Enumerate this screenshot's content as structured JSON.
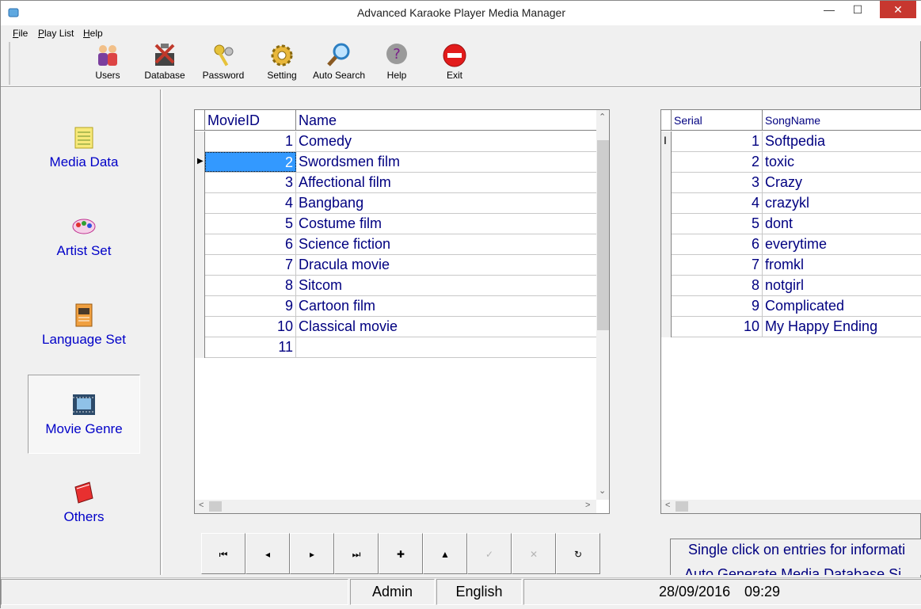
{
  "window": {
    "title": "Advanced Karaoke Player Media Manager"
  },
  "menu": {
    "items": [
      {
        "mnemonic": "F",
        "rest": "ile"
      },
      {
        "mnemonic": "P",
        "rest": "lay List"
      },
      {
        "mnemonic": "H",
        "rest": "elp"
      }
    ]
  },
  "toolbar": {
    "items": [
      {
        "label": "Users",
        "icon": "users-icon"
      },
      {
        "label": "Database",
        "icon": "database-tools-icon"
      },
      {
        "label": "Password",
        "icon": "keys-icon"
      },
      {
        "label": "Setting",
        "icon": "gear-icon"
      },
      {
        "label": "Auto Search",
        "icon": "magnifier-icon"
      },
      {
        "label": "Help",
        "icon": "help-icon"
      },
      {
        "label": "Exit",
        "icon": "exit-icon"
      }
    ]
  },
  "sidebar": {
    "items": [
      {
        "label": "Media Data",
        "icon": "media-data-icon"
      },
      {
        "label": "Artist Set",
        "icon": "artist-set-icon"
      },
      {
        "label": "Language Set",
        "icon": "language-set-icon"
      },
      {
        "label": "Movie Genre",
        "icon": "movie-genre-icon",
        "active": true
      },
      {
        "label": "Others",
        "icon": "others-icon"
      }
    ]
  },
  "genre_grid": {
    "headers": [
      "MovieID",
      "Name"
    ],
    "rows": [
      {
        "id": "1",
        "name": "Comedy"
      },
      {
        "id": "2",
        "name": "Swordsmen film",
        "selected": true
      },
      {
        "id": "3",
        "name": "Affectional film"
      },
      {
        "id": "4",
        "name": "Bangbang"
      },
      {
        "id": "5",
        "name": "Costume film"
      },
      {
        "id": "6",
        "name": "Science fiction"
      },
      {
        "id": "7",
        "name": "Dracula movie"
      },
      {
        "id": "8",
        "name": "Sitcom"
      },
      {
        "id": "9",
        "name": "Cartoon film"
      },
      {
        "id": "10",
        "name": "Classical movie"
      },
      {
        "id": "11",
        "name": ""
      }
    ]
  },
  "song_grid": {
    "headers": [
      "Serial",
      "SongName"
    ],
    "rows": [
      {
        "serial": "1",
        "name": "Softpedia"
      },
      {
        "serial": "2",
        "name": "toxic"
      },
      {
        "serial": "3",
        "name": "Crazy"
      },
      {
        "serial": "4",
        "name": "crazykl"
      },
      {
        "serial": "5",
        "name": "dont"
      },
      {
        "serial": "6",
        "name": "everytime"
      },
      {
        "serial": "7",
        "name": "fromkl"
      },
      {
        "serial": "8",
        "name": "notgirl"
      },
      {
        "serial": "9",
        "name": "Complicated"
      },
      {
        "serial": "10",
        "name": "My Happy Ending"
      }
    ]
  },
  "navigator": {
    "buttons": [
      {
        "name": "first-record-button",
        "glyph": "⏮",
        "enabled": true
      },
      {
        "name": "prior-record-button",
        "glyph": "◂",
        "enabled": true
      },
      {
        "name": "next-record-button",
        "glyph": "▸",
        "enabled": true
      },
      {
        "name": "last-record-button",
        "glyph": "⏭",
        "enabled": true
      },
      {
        "name": "insert-record-button",
        "glyph": "✚",
        "enabled": true
      },
      {
        "name": "delete-record-button",
        "glyph": "▲",
        "enabled": true
      },
      {
        "name": "post-record-button",
        "glyph": "✓",
        "enabled": false
      },
      {
        "name": "cancel-record-button",
        "glyph": "✕",
        "enabled": false
      },
      {
        "name": "refresh-record-button",
        "glyph": "↻",
        "enabled": true
      }
    ]
  },
  "info": {
    "line1": "Single click on entries for informati",
    "line2": "Auto Generate Media Database Si"
  },
  "status": {
    "user": "Admin",
    "language": "English",
    "date": "28/09/2016",
    "time": "09:29"
  }
}
